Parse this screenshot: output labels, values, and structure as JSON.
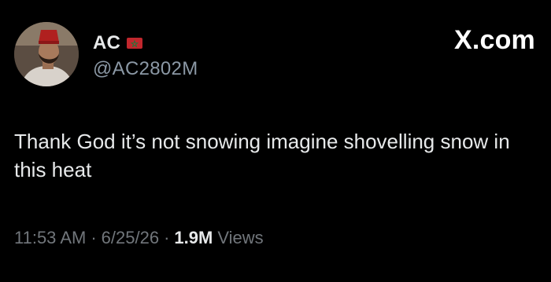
{
  "header": {
    "display_name": "AC",
    "handle": "@AC2802M",
    "brand": "X.com"
  },
  "icons": {
    "flag": "morocco-flag-icon",
    "avatar": "profile-photo"
  },
  "tweet": {
    "text": "Thank God it’s not snowing imagine shovelling snow in this heat"
  },
  "meta": {
    "time": "11:53 AM",
    "separator": "·",
    "date": "6/25/26",
    "views_count": "1.9M",
    "views_label": "Views"
  },
  "colors": {
    "background": "#000000",
    "text_primary": "#e7e9ea",
    "text_secondary": "#71767b",
    "flag_red": "#c1272d"
  }
}
